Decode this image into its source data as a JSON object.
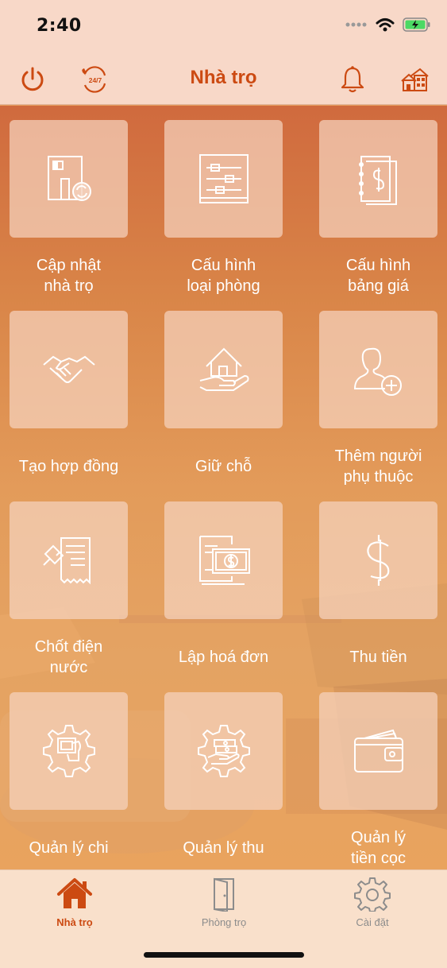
{
  "status_bar": {
    "time": "2:40"
  },
  "header": {
    "title": "Nhà trọ",
    "left_icons": [
      "power-icon",
      "support-24-7-icon"
    ],
    "right_icons": [
      "bell-icon",
      "houses-icon"
    ],
    "support_badge": "24/7"
  },
  "menu": {
    "items": [
      {
        "label": "Cập nhật\nnhà trọ",
        "icon": "house-update-icon"
      },
      {
        "label": "Cấu hình\nloại phòng",
        "icon": "sliders-icon"
      },
      {
        "label": "Cấu hình\nbảng giá",
        "icon": "price-book-icon"
      },
      {
        "label": "Tạo hợp đồng",
        "icon": "handshake-icon"
      },
      {
        "label": "Giữ chỗ",
        "icon": "house-in-hand-icon"
      },
      {
        "label": "Thêm người\nphụ thuộc",
        "icon": "add-person-icon"
      },
      {
        "label": "Chốt điện\nnước",
        "icon": "receipt-pin-icon"
      },
      {
        "label": "Lập hoá đơn",
        "icon": "invoice-money-icon"
      },
      {
        "label": "Thu tiền",
        "icon": "dollar-icon"
      },
      {
        "label": "Quản lý chi",
        "icon": "expense-gear-icon"
      },
      {
        "label": "Quản lý thu",
        "icon": "income-gear-icon"
      },
      {
        "label": "Quản lý\ntiền cọc",
        "icon": "wallet-icon"
      }
    ]
  },
  "tabs": [
    {
      "label": "Nhà trọ",
      "icon": "home-icon",
      "active": true
    },
    {
      "label": "Phòng trọ",
      "icon": "door-icon",
      "active": false
    },
    {
      "label": "Cài đặt",
      "icon": "gear-icon",
      "active": false
    }
  ],
  "colors": {
    "accent": "#cc4a12",
    "header_bg": "#f8d8c8",
    "tabbar_bg": "#f9e0cb"
  }
}
